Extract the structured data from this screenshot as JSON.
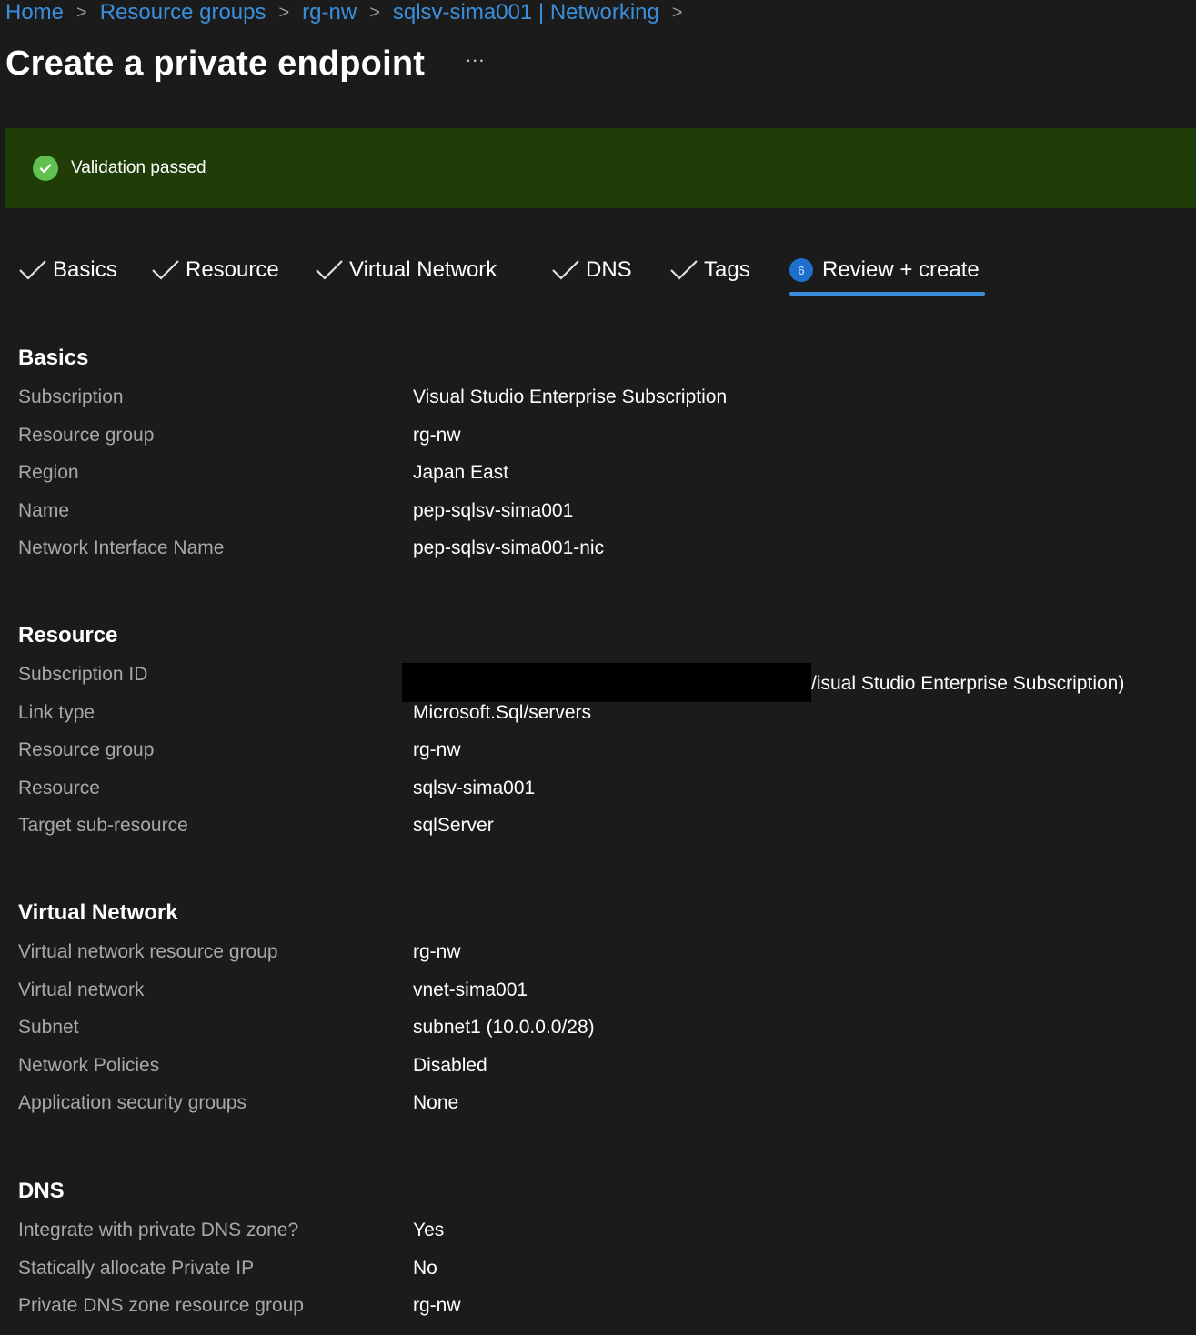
{
  "breadcrumb": {
    "items": [
      "Home",
      "Resource groups",
      "rg-nw",
      "sqlsv-sima001 | Networking"
    ],
    "separator": ">"
  },
  "header": {
    "title": "Create a private endpoint",
    "more_label": "···"
  },
  "validation": {
    "text": "Validation passed",
    "status_color": "#60c050",
    "banner_color": "#203d07"
  },
  "tabs": [
    {
      "label": "Basics",
      "state": "done"
    },
    {
      "label": "Resource",
      "state": "done"
    },
    {
      "label": "Virtual Network",
      "state": "done"
    },
    {
      "label": "DNS",
      "state": "done"
    },
    {
      "label": "Tags",
      "state": "done"
    },
    {
      "label": "Review + create",
      "state": "active",
      "step": "6"
    }
  ],
  "sections": {
    "basics": {
      "title": "Basics",
      "rows": [
        {
          "label": "Subscription",
          "value": "Visual Studio Enterprise Subscription"
        },
        {
          "label": "Resource group",
          "value": "rg-nw"
        },
        {
          "label": "Region",
          "value": "Japan East"
        },
        {
          "label": "Name",
          "value": "pep-sqlsv-sima001"
        },
        {
          "label": "Network Interface Name",
          "value": "pep-sqlsv-sima001-nic"
        }
      ]
    },
    "resource": {
      "title": "Resource",
      "rows": [
        {
          "label": "Subscription ID",
          "value": "/isual Studio Enterprise Subscription)"
        },
        {
          "label": "Link type",
          "value": "Microsoft.Sql/servers"
        },
        {
          "label": "Resource group",
          "value": "rg-nw"
        },
        {
          "label": "Resource",
          "value": "sqlsv-sima001"
        },
        {
          "label": "Target sub-resource",
          "value": "sqlServer"
        }
      ]
    },
    "virtual_network": {
      "title": "Virtual Network",
      "rows": [
        {
          "label": "Virtual network resource group",
          "value": "rg-nw"
        },
        {
          "label": "Virtual network",
          "value": "vnet-sima001"
        },
        {
          "label": "Subnet",
          "value": "subnet1 (10.0.0.0/28)"
        },
        {
          "label": "Network Policies",
          "value": "Disabled"
        },
        {
          "label": "Application security groups",
          "value": "None"
        }
      ]
    },
    "dns": {
      "title": "DNS",
      "rows": [
        {
          "label": "Integrate with private DNS zone?",
          "value": "Yes"
        },
        {
          "label": "Statically allocate Private IP",
          "value": "No"
        },
        {
          "label": "Private DNS zone resource group",
          "value": "rg-nw"
        }
      ]
    }
  },
  "colors": {
    "background": "#1b1b1b",
    "link": "#3a8fdc",
    "label": "#a8a8a8",
    "accent": "#1f6fcf"
  }
}
